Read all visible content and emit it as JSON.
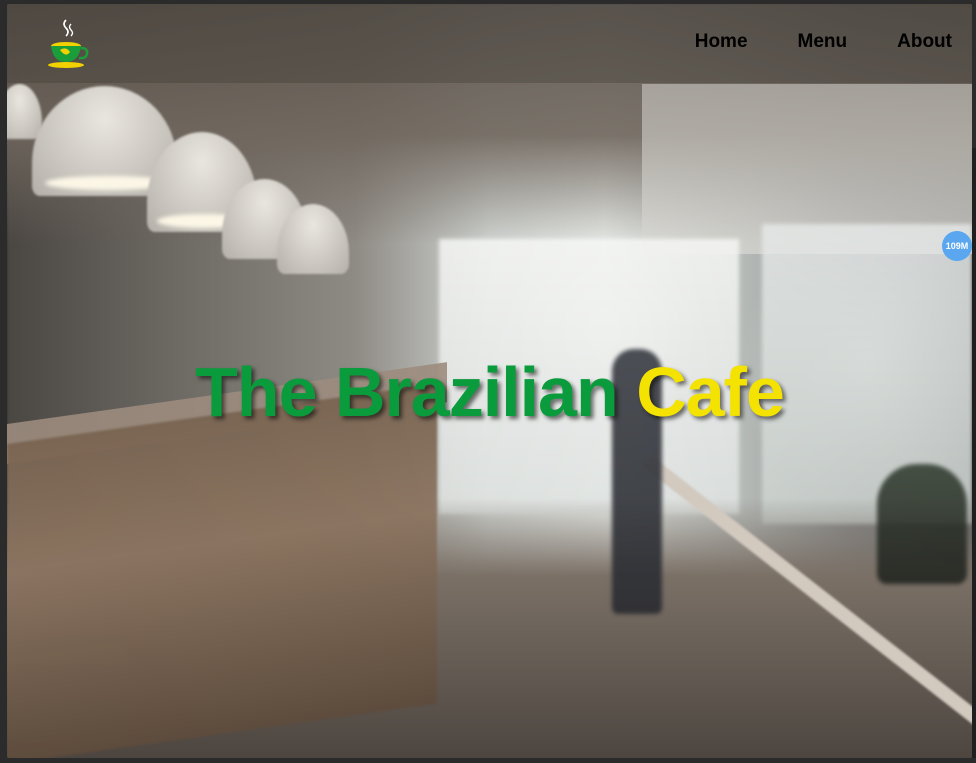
{
  "nav": {
    "items": [
      {
        "label": "Home"
      },
      {
        "label": "Menu"
      },
      {
        "label": "About"
      }
    ]
  },
  "hero": {
    "title_part1": "The Brazilian",
    "title_part2": "Cafe"
  },
  "badge": {
    "text": "109M"
  },
  "colors": {
    "brand_green": "#0a9b3c",
    "brand_yellow": "#f4e200",
    "badge_blue": "#5aa7f0"
  },
  "icons": {
    "logo": "coffee-cup-icon"
  }
}
